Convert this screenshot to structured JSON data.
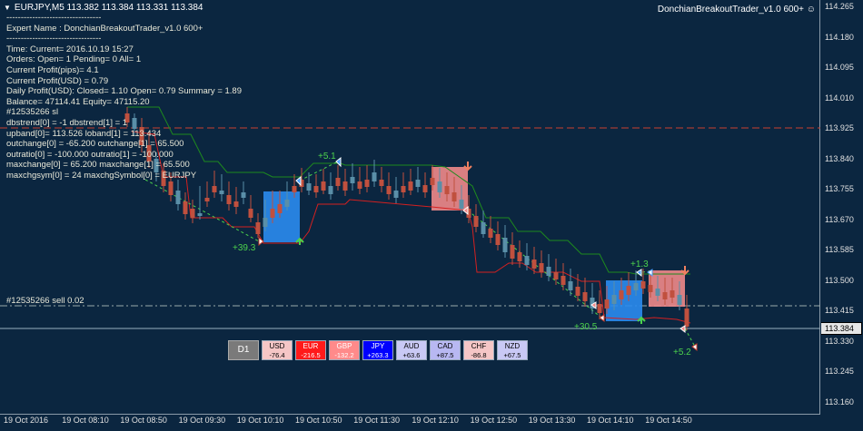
{
  "header": {
    "title": "EURJPY,M5  113.382 113.384 113.331 113.384",
    "ea_name": "DonchianBreakoutTrader_v1.0 600+"
  },
  "info_panel": {
    "lines": [
      "---------------------------------",
      "Expert Name : DonchianBreakoutTrader_v1.0 600+",
      "---------------------------------",
      "Time: Current= 2016.10.19 15:27",
      "Orders: Open= 1 Pending= 0 All= 1",
      "Current Profit(pips)= 4.1",
      "Current Profit(USD) = 0.79",
      "Daily Profit(USD): Closed= 1.10 Open= 0.79 Summary = 1.89",
      "Balance= 47114.41 Equity= 47115.20",
      "#12535266 sl",
      "dbstrend[0] = -1 dbstrend[1] = 1",
      "upband[0]= 113.526 loband[1] = 113.434",
      "outchange[0] = -65.200 outchange[1] = 65.500",
      "outratio[0] = -100.000 outratio[1] = -100.000",
      "maxchange[0] = 65.200 maxchange[1] = 65.500",
      "maxchgsym[0] = 24 maxchgSymbol[0] = EURJPY"
    ]
  },
  "order_label": "#12535266 sell 0.02",
  "price_axis": {
    "labels": [
      "114.265",
      "114.180",
      "114.095",
      "114.010",
      "113.925",
      "113.840",
      "113.755",
      "113.670",
      "113.585",
      "113.500",
      "113.415",
      "113.330",
      "113.245",
      "113.160"
    ],
    "current_price": "113.384"
  },
  "time_axis": {
    "labels": [
      "19 Oct 2016",
      "19 Oct 08:10",
      "19 Oct 08:50",
      "19 Oct 09:30",
      "19 Oct 10:10",
      "19 Oct 10:50",
      "19 Oct 11:30",
      "19 Oct 12:10",
      "19 Oct 12:50",
      "19 Oct 13:30",
      "19 Oct 14:10",
      "19 Oct 14:50"
    ]
  },
  "trade_labels": {
    "t1": "+39.3",
    "t2": "+5.1",
    "t3": "+30.5",
    "t4": "+1.3",
    "t5": "+5.2"
  },
  "currency_strip": {
    "d1": "D1",
    "cells": [
      {
        "name": "USD",
        "value": "-76.4",
        "bg": "#f5c6c6",
        "fg": "#000000"
      },
      {
        "name": "EUR",
        "value": "-216.5",
        "bg": "#ff1a1a",
        "fg": "#ffffff"
      },
      {
        "name": "GBP",
        "value": "-132.2",
        "bg": "#ff8a8a",
        "fg": "#ffffff"
      },
      {
        "name": "JPY",
        "value": "+263.3",
        "bg": "#0000ff",
        "fg": "#ffffff"
      },
      {
        "name": "AUD",
        "value": "+63.6",
        "bg": "#c9c9f5",
        "fg": "#000000"
      },
      {
        "name": "CAD",
        "value": "+87.5",
        "bg": "#b8b8f2",
        "fg": "#000000"
      },
      {
        "name": "CHF",
        "value": "-86.8",
        "bg": "#f5c6c6",
        "fg": "#000000"
      },
      {
        "name": "NZD",
        "value": "+67.5",
        "bg": "#c9c9f5",
        "fg": "#000000"
      }
    ]
  },
  "colors": {
    "background": "#0b2640",
    "bull_candle": "#5a8fa8",
    "bear_candle": "#c0503e",
    "upper_band": "#1e8a1e",
    "lower_band": "#d42020",
    "trade_line": "#4cd24c",
    "buy_box": "#2a8cf0",
    "sell_box": "#f08a8a"
  }
}
